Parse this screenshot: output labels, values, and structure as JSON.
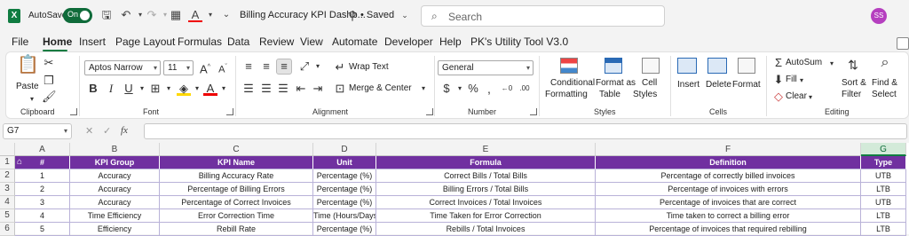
{
  "titlebar": {
    "autosave_label": "AutoSave",
    "autosave_state": "On",
    "doc_title": "Billing Accuracy KPI Dashb...",
    "saved_status": "• Saved",
    "search_placeholder": "Search",
    "user_initials": "SS"
  },
  "menu": [
    "File",
    "Home",
    "Insert",
    "Page Layout",
    "Formulas",
    "Data",
    "Review",
    "View",
    "Automate",
    "Developer",
    "Help",
    "PK's Utility Tool V3.0"
  ],
  "ribbon": {
    "clipboard": {
      "paste": "Paste",
      "label": "Clipboard"
    },
    "font": {
      "name": "Aptos Narrow",
      "size": "11",
      "label": "Font"
    },
    "alignment": {
      "wrap": "Wrap Text",
      "merge": "Merge & Center",
      "label": "Alignment"
    },
    "number": {
      "format": "General",
      "label": "Number"
    },
    "styles": {
      "cond1": "Conditional",
      "cond2": "Formatting",
      "fmt1": "Format as",
      "fmt2": "Table",
      "cell1": "Cell",
      "cell2": "Styles",
      "label": "Styles"
    },
    "cells": {
      "insert": "Insert",
      "delete": "Delete",
      "format": "Format",
      "label": "Cells"
    },
    "editing": {
      "autosum": "AutoSum",
      "fill": "Fill",
      "clear": "Clear",
      "sort1": "Sort &",
      "sort2": "Filter",
      "find1": "Find &",
      "find2": "Select",
      "label": "Editing"
    }
  },
  "formula_bar": {
    "name_box": "G7",
    "fx": "fx",
    "value": ""
  },
  "sheet": {
    "columns": [
      "A",
      "B",
      "C",
      "D",
      "E",
      "F",
      "G"
    ],
    "selected_column": "G",
    "row_numbers": [
      "1",
      "2",
      "3",
      "4",
      "5",
      "6"
    ],
    "header": [
      "#",
      "KPI Group",
      "KPI Name",
      "Unit",
      "Formula",
      "Definition",
      "Type"
    ],
    "rows": [
      [
        "1",
        "Accuracy",
        "Billing Accuracy Rate",
        "Percentage (%)",
        "Correct Bills / Total Bills",
        "Percentage of correctly billed invoices",
        "UTB"
      ],
      [
        "2",
        "Accuracy",
        "Percentage of Billing Errors",
        "Percentage (%)",
        "Billing Errors / Total Bills",
        "Percentage of invoices with errors",
        "LTB"
      ],
      [
        "3",
        "Accuracy",
        "Percentage of Correct Invoices",
        "Percentage (%)",
        "Correct Invoices / Total Invoices",
        "Percentage of invoices that are correct",
        "UTB"
      ],
      [
        "4",
        "Time Efficiency",
        "Error Correction Time",
        "Time (Hours/Days)",
        "Time Taken for Error Correction",
        "Time taken to correct a billing error",
        "LTB"
      ],
      [
        "5",
        "Efficiency",
        "Rebill Rate",
        "Percentage (%)",
        "Rebills / Total Invoices",
        "Percentage of invoices that required rebilling",
        "LTB"
      ]
    ]
  },
  "colors": {
    "excel_green": "#107c41",
    "header_purple": "#7030a0",
    "avatar": "#b53fbf"
  }
}
